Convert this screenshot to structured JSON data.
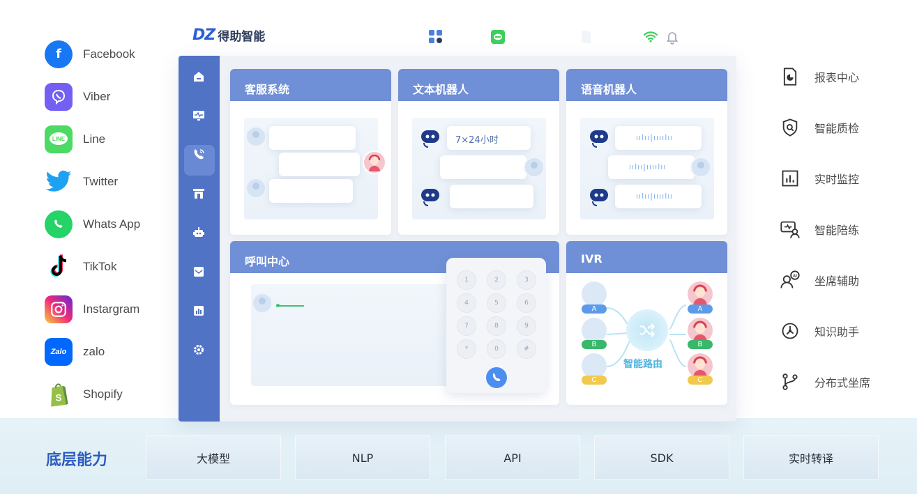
{
  "social": [
    {
      "label": "Facebook",
      "icon": "facebook-icon",
      "color": "#1877f2"
    },
    {
      "label": "Viber",
      "icon": "viber-icon",
      "color": "#7360f2"
    },
    {
      "label": "Line",
      "icon": "line-icon",
      "color": "#06c755"
    },
    {
      "label": "Twitter",
      "icon": "twitter-icon",
      "color": "#1da1f2"
    },
    {
      "label": "Whats App",
      "icon": "whatsapp-icon",
      "color": "#25d366"
    },
    {
      "label": "TikTok",
      "icon": "tiktok-icon",
      "color": "#000000"
    },
    {
      "label": "Instargram",
      "icon": "instagram-icon",
      "color": "#e1306c"
    },
    {
      "label": "zalo",
      "icon": "zalo-icon",
      "color": "#0068ff"
    },
    {
      "label": "Shopify",
      "icon": "shopify-icon",
      "color": "#95bf47"
    }
  ],
  "brand": {
    "mark": "DZ",
    "name": "得助智能"
  },
  "cards": {
    "customer_service": {
      "title": "客服系统"
    },
    "text_bot": {
      "title": "文本机器人",
      "message": "7×24小时"
    },
    "voice_bot": {
      "title": "语音机器人",
      "wave": "ıılıı|ıııılıı"
    },
    "call_center": {
      "title": "呼叫中心"
    },
    "ivr": {
      "title": "IVR",
      "router_label": "智能路由",
      "tags": [
        "A",
        "B",
        "C"
      ]
    }
  },
  "keypad": {
    "keys": [
      "1",
      "2",
      "3",
      "4",
      "5",
      "6",
      "7",
      "8",
      "9",
      "*",
      "0",
      "#"
    ]
  },
  "features": [
    {
      "label": "报表中心",
      "icon": "report-icon"
    },
    {
      "label": "智能质检",
      "icon": "quality-shield-icon"
    },
    {
      "label": "实时监控",
      "icon": "monitor-chart-icon"
    },
    {
      "label": "智能陪练",
      "icon": "training-icon"
    },
    {
      "label": "坐席辅助",
      "icon": "ai-assist-icon"
    },
    {
      "label": "知识助手",
      "icon": "knowledge-icon"
    },
    {
      "label": "分布式坐席",
      "icon": "branch-icon"
    }
  ],
  "capabilities": {
    "title": "底层能力",
    "items": [
      "大模型",
      "NLP",
      "API",
      "SDK",
      "实时转译"
    ]
  },
  "colors": {
    "primary": "#5173c6",
    "header": "#6f8fd6",
    "accent": "#2d5cbf",
    "tag_a": "#5b9bea",
    "tag_b": "#39b86b",
    "tag_c": "#f2c94c"
  }
}
